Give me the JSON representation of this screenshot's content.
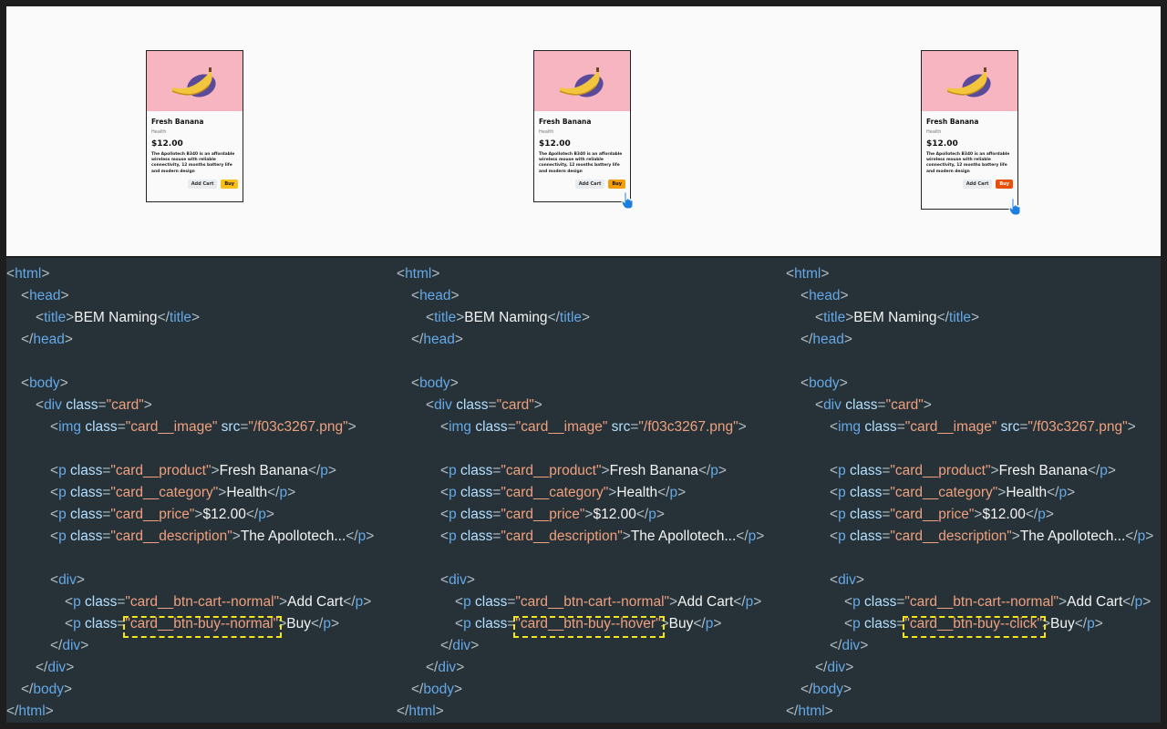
{
  "card": {
    "product": "Fresh Banana",
    "category": "Health",
    "price": "$12.00",
    "description": "The Apollotech B340 is an affordable wireless mouse with reliable connectivity, 12 months battery life and modern design",
    "add_cart": "Add Cart",
    "buy": "Buy"
  },
  "states": [
    {
      "state": "normal",
      "buy_color": "#fbbf16",
      "buy_text_color": "#111111",
      "cursor": false,
      "buy_class": "\"card__btn-buy--normal\""
    },
    {
      "state": "hover",
      "buy_color": "#f59e0b",
      "buy_text_color": "#111111",
      "cursor": true,
      "buy_class": "\"card__btn-buy--hover\""
    },
    {
      "state": "click",
      "buy_color": "#e8500a",
      "buy_text_color": "#ffffff",
      "cursor": true,
      "buy_class": "\"card__btn-buy--click\""
    }
  ],
  "code_lines": [
    {
      "indent": 0,
      "tokens": [
        [
          "br",
          "<"
        ],
        [
          "tag",
          "html"
        ],
        [
          "br",
          ">"
        ]
      ]
    },
    {
      "indent": 1,
      "tokens": [
        [
          "br",
          "<"
        ],
        [
          "tag",
          "head"
        ],
        [
          "br",
          ">"
        ]
      ]
    },
    {
      "indent": 2,
      "tokens": [
        [
          "br",
          "<"
        ],
        [
          "tag",
          "title"
        ],
        [
          "br",
          ">"
        ],
        [
          "txt",
          "BEM Naming"
        ],
        [
          "br",
          "</"
        ],
        [
          "tag",
          "title"
        ],
        [
          "br",
          ">"
        ]
      ]
    },
    {
      "indent": 1,
      "tokens": [
        [
          "br",
          "</"
        ],
        [
          "tag",
          "head"
        ],
        [
          "br",
          ">"
        ]
      ]
    },
    {
      "indent": 0,
      "tokens": []
    },
    {
      "indent": 1,
      "tokens": [
        [
          "br",
          "<"
        ],
        [
          "tag",
          "body"
        ],
        [
          "br",
          ">"
        ]
      ]
    },
    {
      "indent": 2,
      "tokens": [
        [
          "br",
          "<"
        ],
        [
          "tag",
          "div "
        ],
        [
          "attr",
          "class"
        ],
        [
          "br",
          "="
        ],
        [
          "str",
          "\"card\""
        ],
        [
          "br",
          ">"
        ]
      ]
    },
    {
      "indent": 3,
      "tokens": [
        [
          "br",
          "<"
        ],
        [
          "tag",
          "img "
        ],
        [
          "attr",
          "class"
        ],
        [
          "br",
          "="
        ],
        [
          "str",
          "\"card__image\" "
        ],
        [
          "attr",
          "src"
        ],
        [
          "br",
          "="
        ],
        [
          "str",
          "\"/f03c3267.png\""
        ],
        [
          "br",
          ">"
        ]
      ]
    },
    {
      "indent": 0,
      "tokens": []
    },
    {
      "indent": 3,
      "tokens": [
        [
          "br",
          "<"
        ],
        [
          "tag",
          "p "
        ],
        [
          "attr",
          "class"
        ],
        [
          "br",
          "="
        ],
        [
          "str",
          "\"card__product\""
        ],
        [
          "br",
          ">"
        ],
        [
          "txt",
          "Fresh Banana"
        ],
        [
          "br",
          "</"
        ],
        [
          "tag",
          "p"
        ],
        [
          "br",
          ">"
        ]
      ]
    },
    {
      "indent": 3,
      "tokens": [
        [
          "br",
          "<"
        ],
        [
          "tag",
          "p "
        ],
        [
          "attr",
          "class"
        ],
        [
          "br",
          "="
        ],
        [
          "str",
          "\"card__category\""
        ],
        [
          "br",
          ">"
        ],
        [
          "txt",
          "Health"
        ],
        [
          "br",
          "</"
        ],
        [
          "tag",
          "p"
        ],
        [
          "br",
          ">"
        ]
      ]
    },
    {
      "indent": 3,
      "tokens": [
        [
          "br",
          "<"
        ],
        [
          "tag",
          "p "
        ],
        [
          "attr",
          "class"
        ],
        [
          "br",
          "="
        ],
        [
          "str",
          "\"card__price\""
        ],
        [
          "br",
          ">"
        ],
        [
          "txt",
          "$12.00"
        ],
        [
          "br",
          "</"
        ],
        [
          "tag",
          "p"
        ],
        [
          "br",
          ">"
        ]
      ]
    },
    {
      "indent": 3,
      "tokens": [
        [
          "br",
          "<"
        ],
        [
          "tag",
          "p "
        ],
        [
          "attr",
          "class"
        ],
        [
          "br",
          "="
        ],
        [
          "str",
          "\"card__description\""
        ],
        [
          "br",
          ">"
        ],
        [
          "txt",
          "The Apollotech..."
        ],
        [
          "br",
          "</"
        ],
        [
          "tag",
          "p"
        ],
        [
          "br",
          ">"
        ]
      ]
    },
    {
      "indent": 0,
      "tokens": []
    },
    {
      "indent": 3,
      "tokens": [
        [
          "br",
          "<"
        ],
        [
          "tag",
          "div"
        ],
        [
          "br",
          ">"
        ]
      ]
    },
    {
      "indent": 4,
      "tokens": [
        [
          "br",
          "<"
        ],
        [
          "tag",
          "p "
        ],
        [
          "attr",
          "class"
        ],
        [
          "br",
          "="
        ],
        [
          "str",
          "\"card__btn-cart--normal\""
        ],
        [
          "br",
          ">"
        ],
        [
          "txt",
          "Add Cart"
        ],
        [
          "br",
          "</"
        ],
        [
          "tag",
          "p"
        ],
        [
          "br",
          ">"
        ]
      ]
    },
    {
      "indent": 4,
      "tokens": [
        [
          "br",
          "<"
        ],
        [
          "tag",
          "p "
        ],
        [
          "attr",
          "class"
        ],
        [
          "br",
          "="
        ],
        [
          "buyclass",
          ""
        ],
        [
          "br",
          ">"
        ],
        [
          "txt",
          "Buy"
        ],
        [
          "br",
          "</"
        ],
        [
          "tag",
          "p"
        ],
        [
          "br",
          ">"
        ]
      ]
    },
    {
      "indent": 3,
      "tokens": [
        [
          "br",
          "</"
        ],
        [
          "tag",
          "div"
        ],
        [
          "br",
          ">"
        ]
      ]
    },
    {
      "indent": 2,
      "tokens": [
        [
          "br",
          "</"
        ],
        [
          "tag",
          "div"
        ],
        [
          "br",
          ">"
        ]
      ]
    },
    {
      "indent": 1,
      "tokens": [
        [
          "br",
          "</"
        ],
        [
          "tag",
          "body"
        ],
        [
          "br",
          ">"
        ]
      ]
    },
    {
      "indent": 0,
      "tokens": [
        [
          "br",
          "</"
        ],
        [
          "tag",
          "html"
        ],
        [
          "br",
          ">"
        ]
      ]
    }
  ]
}
